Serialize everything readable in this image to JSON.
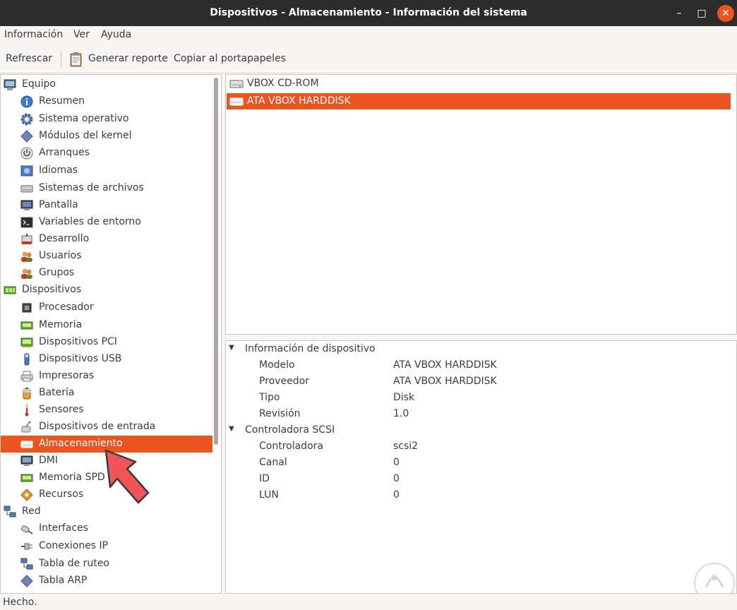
{
  "window": {
    "title": "Dispositivos - Almacenamiento - Información del sistema",
    "minimize_glyph": "–",
    "maximize_glyph": "□",
    "close_glyph": "✕"
  },
  "menubar": {
    "items": [
      "Información",
      "Ver",
      "Ayuda"
    ]
  },
  "toolbar": {
    "refresh_label": "Refrescar",
    "report_label": "Generar reporte",
    "copy_label": "Copiar al portapapeles"
  },
  "sidebar": {
    "items": [
      {
        "label": "Equipo",
        "icon": "computer-icon"
      },
      {
        "label": "Resumen",
        "icon": "info-icon"
      },
      {
        "label": "Sistema operativo",
        "icon": "gear-icon"
      },
      {
        "label": "Módulos del kernel",
        "icon": "diamond-icon"
      },
      {
        "label": "Arranques",
        "icon": "power-icon"
      },
      {
        "label": "Idiomas",
        "icon": "flag-icon"
      },
      {
        "label": "Sistemas de archivos",
        "icon": "drive-icon"
      },
      {
        "label": "Pantalla",
        "icon": "monitor-icon"
      },
      {
        "label": "Variables de entorno",
        "icon": "terminal-icon"
      },
      {
        "label": "Desarrollo",
        "icon": "devtools-icon"
      },
      {
        "label": "Usuarios",
        "icon": "users-icon"
      },
      {
        "label": "Grupos",
        "icon": "groups-icon"
      },
      {
        "label": "Dispositivos",
        "icon": "board-icon"
      },
      {
        "label": "Procesador",
        "icon": "cpu-icon"
      },
      {
        "label": "Memoria",
        "icon": "memory-icon"
      },
      {
        "label": "Dispositivos PCI",
        "icon": "pci-icon"
      },
      {
        "label": "Dispositivos USB",
        "icon": "usb-icon"
      },
      {
        "label": "Impresoras",
        "icon": "printer-icon"
      },
      {
        "label": "Batería",
        "icon": "battery-icon"
      },
      {
        "label": "Sensores",
        "icon": "thermometer-icon"
      },
      {
        "label": "Dispositivos de entrada",
        "icon": "input-device-icon"
      },
      {
        "label": "Almacenamiento",
        "icon": "storage-icon"
      },
      {
        "label": "DMI",
        "icon": "dmi-icon"
      },
      {
        "label": "Memoria SPD",
        "icon": "spd-icon"
      },
      {
        "label": "Recursos",
        "icon": "resources-icon"
      },
      {
        "label": "Red",
        "icon": "network-icon"
      },
      {
        "label": "Interfaces",
        "icon": "interfaces-icon"
      },
      {
        "label": "Conexiones IP",
        "icon": "plug-icon"
      },
      {
        "label": "Tabla de ruteo",
        "icon": "routing-icon"
      },
      {
        "label": "Tabla ARP",
        "icon": "arp-icon"
      }
    ],
    "selected": "Almacenamiento"
  },
  "devices": {
    "items": [
      {
        "label": "VBOX CD-ROM",
        "icon": "cdrom-icon"
      },
      {
        "label": "ATA VBOX HARDDISK",
        "icon": "harddisk-icon"
      }
    ],
    "selected": "ATA VBOX HARDDISK"
  },
  "details": {
    "sections": [
      {
        "title": "Información de dispositivo",
        "rows": [
          {
            "key": "Modelo",
            "value": "ATA VBOX HARDDISK"
          },
          {
            "key": "Proveedor",
            "value": "ATA VBOX HARDDISK"
          },
          {
            "key": "Tipo",
            "value": "Disk"
          },
          {
            "key": "Revisión",
            "value": "1.0"
          }
        ]
      },
      {
        "title": "Controladora SCSI",
        "rows": [
          {
            "key": "Controladora",
            "value": "scsi2"
          },
          {
            "key": "Canal",
            "value": "0"
          },
          {
            "key": "ID",
            "value": "0"
          },
          {
            "key": "LUN",
            "value": "0"
          }
        ]
      }
    ]
  },
  "status": {
    "text": "Hecho."
  },
  "colors": {
    "accent": "#e95420",
    "titlebar": "#2c2c2c",
    "window_bg": "#f6f5f4",
    "pointer_arrow": "#f2545b"
  }
}
